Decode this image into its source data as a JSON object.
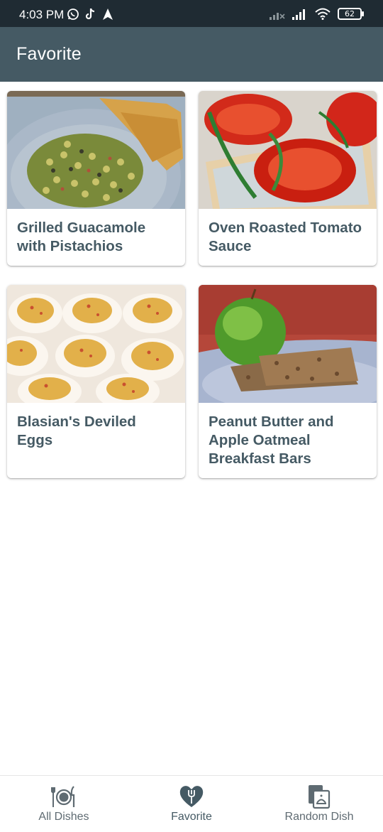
{
  "status_bar": {
    "time": "4:03 PM",
    "battery": "62"
  },
  "app_bar": {
    "title": "Favorite"
  },
  "dishes": [
    {
      "title": "Grilled Guacamole with Pistachios"
    },
    {
      "title": "Oven Roasted Tomato Sauce"
    },
    {
      "title": "Blasian's Deviled Eggs"
    },
    {
      "title": "Peanut Butter and Apple Oatmeal Breakfast Bars"
    }
  ],
  "bottom_nav": {
    "items": [
      {
        "label": "All Dishes",
        "icon": "plate-cutlery-icon"
      },
      {
        "label": "Favorite",
        "icon": "heart-fork-icon",
        "active": true
      },
      {
        "label": "Random Dish",
        "icon": "random-dish-icon"
      }
    ]
  },
  "colors": {
    "app_bar": "#455a64",
    "status_bar": "#1f2b33",
    "title_text": "#455a64"
  }
}
